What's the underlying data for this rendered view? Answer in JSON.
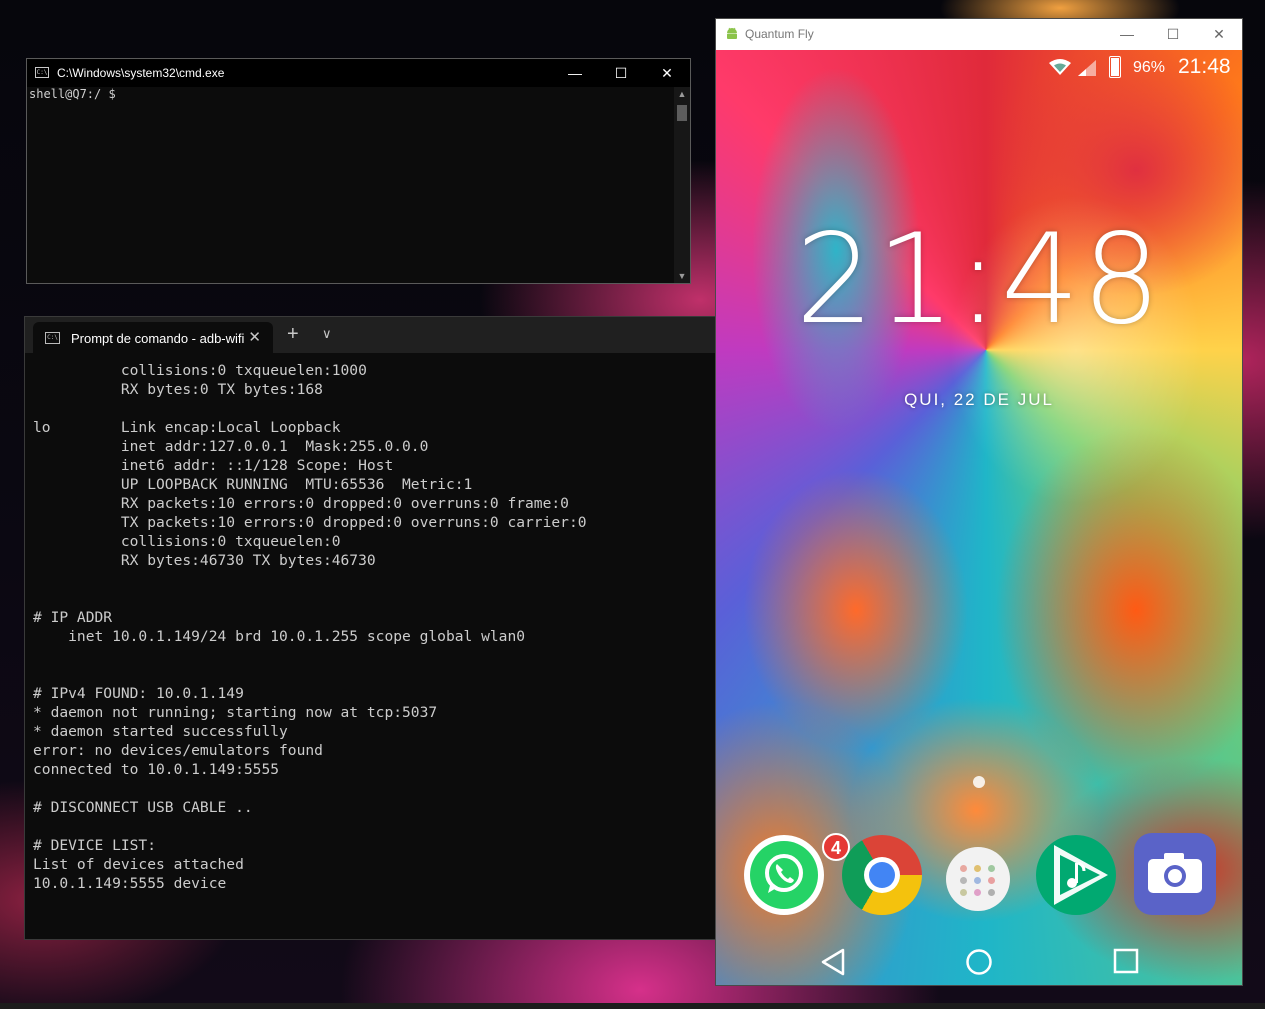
{
  "cmd_window": {
    "title": "C:\\Windows\\system32\\cmd.exe",
    "prompt": "shell@Q7:/ $",
    "icon": "cmd-icon",
    "icon_label": "C:\\"
  },
  "terminal_window": {
    "tab_title": "Prompt de comando - adb-wifi",
    "lines": [
      "          collisions:0 txqueuelen:1000",
      "          RX bytes:0 TX bytes:168",
      "",
      "lo        Link encap:Local Loopback",
      "          inet addr:127.0.0.1  Mask:255.0.0.0",
      "          inet6 addr: ::1/128 Scope: Host",
      "          UP LOOPBACK RUNNING  MTU:65536  Metric:1",
      "          RX packets:10 errors:0 dropped:0 overruns:0 frame:0",
      "          TX packets:10 errors:0 dropped:0 overruns:0 carrier:0",
      "          collisions:0 txqueuelen:0",
      "          RX bytes:46730 TX bytes:46730",
      "",
      "",
      "# IP ADDR",
      "    inet 10.0.1.149/24 brd 10.0.1.255 scope global wlan0",
      "",
      "",
      "# IPv4 FOUND: 10.0.1.149",
      "* daemon not running; starting now at tcp:5037",
      "* daemon started successfully",
      "error: no devices/emulators found",
      "connected to 10.0.1.149:5555",
      "",
      "# DISCONNECT USB CABLE ..",
      "",
      "# DEVICE LIST:",
      "List of devices attached",
      "10.0.1.149:5555 device"
    ]
  },
  "phone_window": {
    "title": "Quantum Fly",
    "status_bar": {
      "battery": "96%",
      "time": "21:48"
    },
    "lockscreen": {
      "clock": "21:48",
      "date": "QUI, 22 DE JUL"
    },
    "dock": [
      {
        "app": "WhatsApp",
        "icon": "whatsapp-icon",
        "badge": "4"
      },
      {
        "app": "Chrome",
        "icon": "chrome-icon"
      },
      {
        "app": "Apps",
        "icon": "app-drawer-icon"
      },
      {
        "app": "Play Music",
        "icon": "play-music-icon"
      },
      {
        "app": "Camera",
        "icon": "camera-icon"
      }
    ],
    "nav": [
      "back-icon",
      "home-icon",
      "recents-icon"
    ]
  },
  "colors": {
    "whatsapp": "#25d366",
    "badge": "#e53935",
    "chrome_blue": "#4285f4",
    "play_music": "#01a971",
    "camera": "#5a63c8"
  }
}
